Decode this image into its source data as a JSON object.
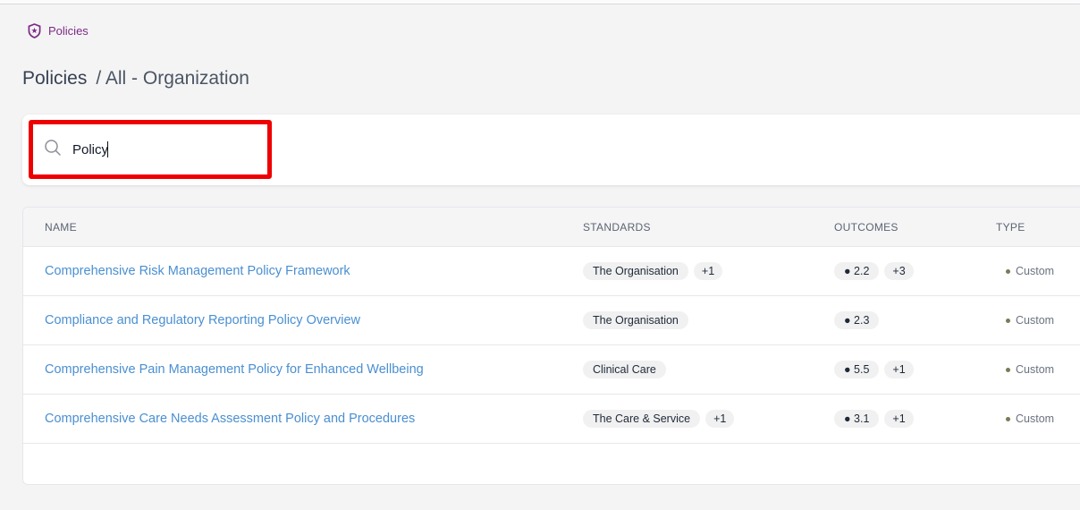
{
  "breadcrumb": {
    "label": "Policies"
  },
  "header": {
    "title": "Policies",
    "subtitle": "/ All - Organization"
  },
  "search": {
    "value": "Policy",
    "placeholder": ""
  },
  "table": {
    "columns": {
      "name": "NAME",
      "standards": "STANDARDS",
      "outcomes": "OUTCOMES",
      "type": "TYPE"
    },
    "rows": [
      {
        "name": "Comprehensive Risk Management Policy Framework",
        "standard": "The Organisation",
        "standard_more": "+1",
        "outcome": "● 2.2",
        "outcome_more": "+3",
        "type": "Custom"
      },
      {
        "name": "Compliance and Regulatory Reporting Policy Overview",
        "standard": "The Organisation",
        "standard_more": "",
        "outcome": "● 2.3",
        "outcome_more": "",
        "type": "Custom"
      },
      {
        "name": "Comprehensive Pain Management Policy for Enhanced Wellbeing",
        "standard": "Clinical Care",
        "standard_more": "",
        "outcome": "● 5.5",
        "outcome_more": "+1",
        "type": "Custom"
      },
      {
        "name": "Comprehensive Care Needs Assessment Policy and Procedures",
        "standard": "The Care & Service",
        "standard_more": "+1",
        "outcome": "● 3.1",
        "outcome_more": "+1",
        "type": "Custom"
      }
    ]
  },
  "colors": {
    "accent": "#4a8fd1",
    "brand": "#7b2a84",
    "highlight": "#ee0000"
  }
}
